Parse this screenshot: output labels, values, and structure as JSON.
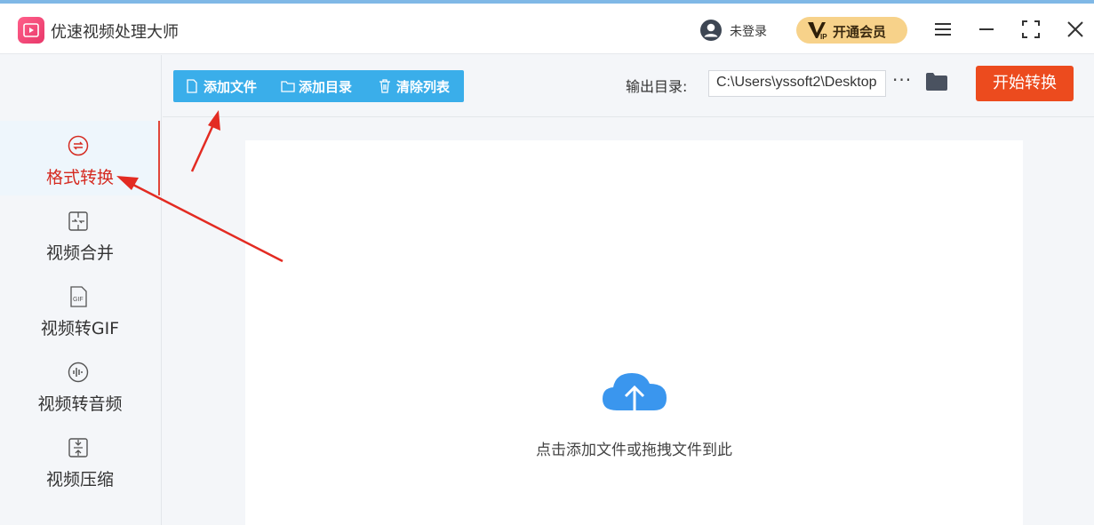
{
  "app": {
    "title": "优速视频处理大师",
    "user_label": "未登录",
    "vip_label": "开通会员"
  },
  "sidebar": {
    "items": [
      {
        "label": "格式转换",
        "icon": "format-convert-icon",
        "active": true
      },
      {
        "label": "视频合并",
        "icon": "merge-icon",
        "active": false
      },
      {
        "label": "视频转GIF",
        "icon": "gif-icon",
        "active": false
      },
      {
        "label": "视频转音频",
        "icon": "audio-icon",
        "active": false
      },
      {
        "label": "视频压缩",
        "icon": "compress-icon",
        "active": false
      }
    ]
  },
  "toolbar": {
    "add_file": "添加文件",
    "add_folder": "添加目录",
    "clear_list": "清除列表",
    "output_label": "输出目录:",
    "output_path": "C:\\Users\\yssoft2\\Desktop",
    "more": "···",
    "start": "开始转换"
  },
  "drop_area": {
    "hint": "点击添加文件或拖拽文件到此"
  },
  "colors": {
    "accent_blue": "#3aaeea",
    "start_red": "#ec4b1e",
    "active_red": "#d52a20",
    "vip_gold": "#f7d28a",
    "annotation_red": "#e32b22"
  }
}
